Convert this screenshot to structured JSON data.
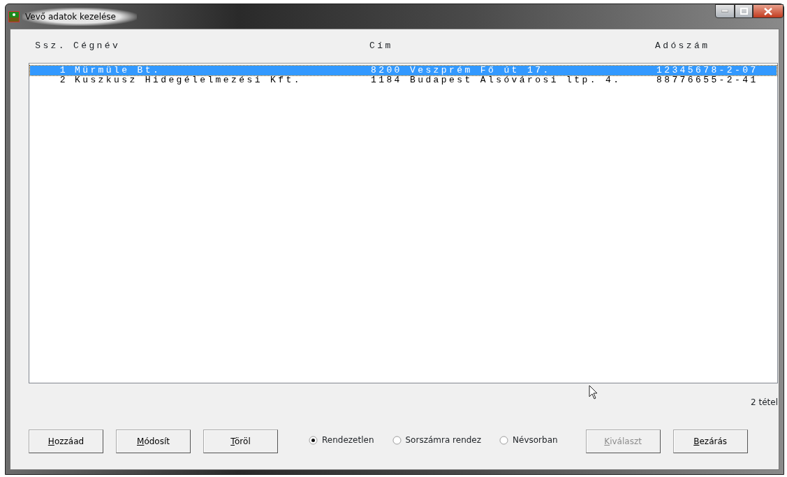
{
  "window": {
    "title": "Vevő adatok kezelése"
  },
  "table": {
    "columns": [
      "Ssz.",
      "Cégnév",
      "Cím",
      "Adószám"
    ],
    "rows": [
      {
        "selected": true,
        "cells": [
          "1",
          "Mürmüle Bt.",
          "8200 Veszprém Fő út 17.",
          "12345678-2-07"
        ]
      },
      {
        "selected": false,
        "cells": [
          "2",
          "Kuszkusz Hidegélelmezési Kft.",
          "1184 Budapest Alsóvárosi ltp. 4.",
          "88776655-2-41"
        ]
      }
    ]
  },
  "item_count": "2 tétel",
  "buttons_left": [
    {
      "label": "Hozzáad",
      "access_key": true,
      "disabled": false
    },
    {
      "label": "Módosít",
      "access_key": true,
      "disabled": false
    },
    {
      "label": "Töröl",
      "access_key": true,
      "disabled": false
    }
  ],
  "sort_options": [
    {
      "label": "Rendezetlen",
      "selected": true
    },
    {
      "label": "Sorszámra rendez",
      "selected": false
    },
    {
      "label": "Névsorban",
      "selected": false
    }
  ],
  "buttons_right": [
    {
      "label": "Kiválaszt",
      "access_key": true,
      "disabled": true
    },
    {
      "label": "Bezárás",
      "access_key": true,
      "disabled": false
    }
  ]
}
